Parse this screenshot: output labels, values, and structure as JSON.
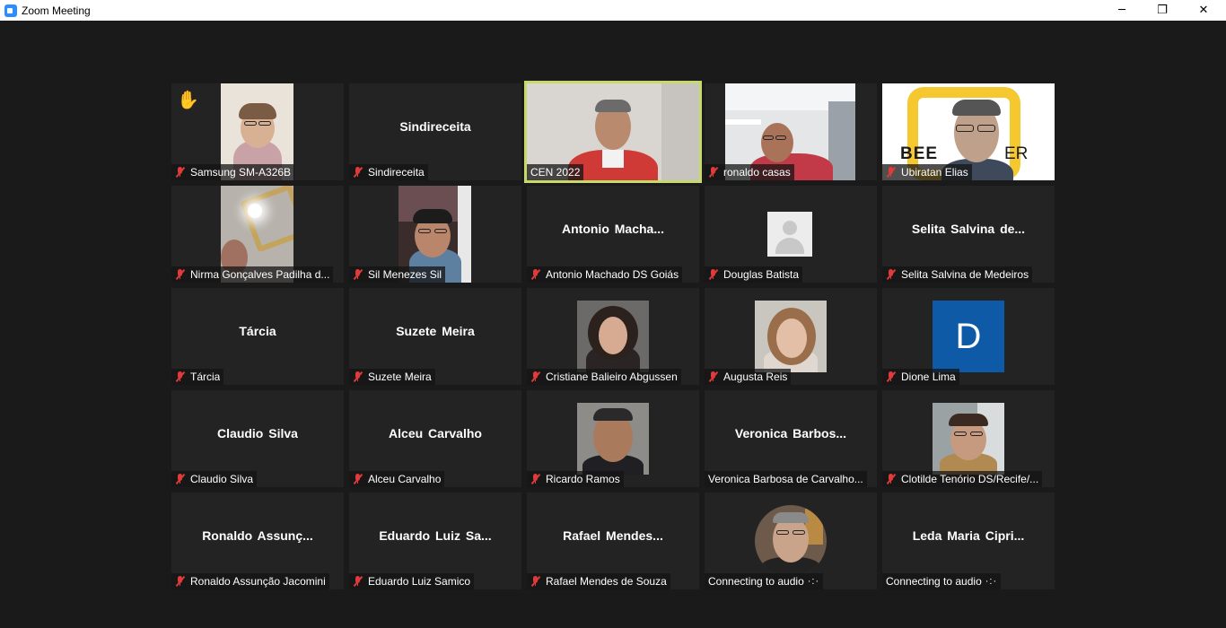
{
  "window": {
    "title": "Zoom Meeting",
    "controls": {
      "minimize": "─",
      "maximize": "❐",
      "close": "✕"
    }
  },
  "participants": [
    {
      "id": "p1",
      "display": "Samsung SM-A326B",
      "muted": true,
      "video": true,
      "hand_raised": true
    },
    {
      "id": "p2",
      "display": "Sindireceita",
      "name_overlay": "Sindireceita",
      "muted": true,
      "video": false
    },
    {
      "id": "p3",
      "display": "CEN 2022",
      "muted": false,
      "video": true,
      "active_speaker": true
    },
    {
      "id": "p4",
      "display": "ronaldo casas",
      "muted": true,
      "video": true
    },
    {
      "id": "p5",
      "display": "Ubiratan Elias",
      "muted": true,
      "video": true,
      "background_text": [
        "BEE",
        "ER"
      ]
    },
    {
      "id": "p6",
      "display": "Nirma Gonçalves Padilha d...",
      "muted": true,
      "video": true
    },
    {
      "id": "p7",
      "display": "Sil Menezes Sil",
      "muted": true,
      "video": true
    },
    {
      "id": "p8",
      "display": "Antonio Machado DS Goiás",
      "name_overlay": "Antonio  Macha...",
      "muted": true,
      "video": false
    },
    {
      "id": "p9",
      "display": "Douglas Batista",
      "muted": true,
      "video": false,
      "avatar": "default-avatar-icon"
    },
    {
      "id": "p10",
      "display": "Selita Salvina de Medeiros",
      "name_overlay": "Selita  Salvina  de...",
      "muted": true,
      "video": false
    },
    {
      "id": "p11",
      "display": "Tárcia",
      "name_overlay": "Tárcia",
      "muted": true,
      "video": false
    },
    {
      "id": "p12",
      "display": "Suzete Meira",
      "name_overlay": "Suzete Meira",
      "muted": true,
      "video": false
    },
    {
      "id": "p13",
      "display": "Cristiane Balieiro Abgussen",
      "muted": true,
      "video": false,
      "avatar": "profile-photo"
    },
    {
      "id": "p14",
      "display": "Augusta Reis",
      "muted": true,
      "video": false,
      "avatar": "profile-photo"
    },
    {
      "id": "p15",
      "display": "Dione Lima",
      "muted": true,
      "video": false,
      "avatar_letter": "D",
      "avatar_color": "#0e5aa7"
    },
    {
      "id": "p16",
      "display": "Claudio Silva",
      "name_overlay": "Claudio Silva",
      "muted": true,
      "video": false
    },
    {
      "id": "p17",
      "display": "Alceu Carvalho",
      "name_overlay": "Alceu Carvalho",
      "muted": true,
      "video": false
    },
    {
      "id": "p18",
      "display": "Ricardo Ramos",
      "muted": true,
      "video": false,
      "avatar": "profile-photo"
    },
    {
      "id": "p19",
      "display": "Veronica Barbosa de Carvalho...",
      "name_overlay": "Veronica  Barbos...",
      "muted": false,
      "video": false
    },
    {
      "id": "p20",
      "display": "Clotilde Tenório DS/Recife/...",
      "muted": true,
      "video": false,
      "avatar": "profile-photo"
    },
    {
      "id": "p21",
      "display": "Ronaldo Assunção Jacomini",
      "name_overlay": "Ronaldo  Assunç...",
      "muted": true,
      "video": false
    },
    {
      "id": "p22",
      "display": "Eduardo Luiz Samico",
      "name_overlay": "Eduardo  Luiz  Sa...",
      "muted": true,
      "video": false
    },
    {
      "id": "p23",
      "display": "Rafael Mendes de Souza",
      "name_overlay": "Rafael  Mendes...",
      "muted": true,
      "video": false
    },
    {
      "id": "p24",
      "display": "Connecting to audio",
      "muted": false,
      "video": false,
      "avatar": "profile-photo",
      "connecting": true
    },
    {
      "id": "p25",
      "display": "Connecting to audio",
      "name_overlay": "Leda  Maria  Cipri...",
      "muted": false,
      "video": false,
      "connecting": true
    }
  ],
  "colors": {
    "stage_bg": "#1a1a1a",
    "tile_bg": "#232323",
    "active_speaker_border": "#c8d96b",
    "muted_icon": "#e03a3a",
    "hand_icon": "#f7c33c"
  }
}
